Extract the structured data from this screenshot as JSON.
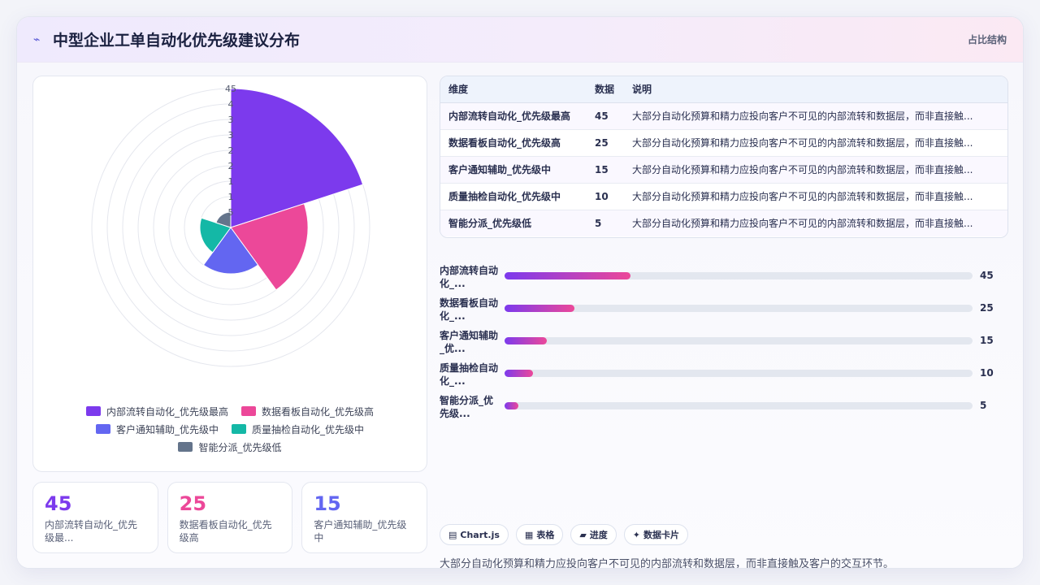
{
  "header": {
    "icon": "chart-icon",
    "title": "中型企业工单自动化优先级建议分布",
    "right_label": "占比结构"
  },
  "colors": {
    "purple": "#7c3aed",
    "pink": "#ec4899",
    "indigo": "#6366f1",
    "teal": "#14b8a6",
    "slate": "#64748b"
  },
  "chart_data": {
    "type": "polarArea",
    "categories": [
      "内部流转自动化_优先级最高",
      "数据看板自动化_优先级高",
      "客户通知辅助_优先级中",
      "质量抽检自动化_优先级中",
      "智能分派_优先级低"
    ],
    "values": [
      45,
      25,
      15,
      10,
      5
    ],
    "colors": [
      "#7c3aed",
      "#ec4899",
      "#6366f1",
      "#14b8a6",
      "#64748b"
    ],
    "rlim": [
      0,
      45
    ],
    "ticks": [
      5,
      10,
      15,
      20,
      25,
      30,
      35,
      40,
      45
    ],
    "tick_labels": [
      "5",
      "1",
      "1",
      "2",
      "2",
      "3",
      "3",
      "4",
      "45"
    ],
    "grid": true,
    "legend_position": "bottom"
  },
  "legend": [
    {
      "label": "内部流转自动化_优先级最高",
      "color": "#7c3aed"
    },
    {
      "label": "数据看板自动化_优先级高",
      "color": "#ec4899"
    },
    {
      "label": "客户通知辅助_优先级中",
      "color": "#6366f1"
    },
    {
      "label": "质量抽检自动化_优先级中",
      "color": "#14b8a6"
    },
    {
      "label": "智能分派_优先级低",
      "color": "#64748b"
    }
  ],
  "kpis": [
    {
      "value": "45",
      "label": "内部流转自动化_优先级最...",
      "color": "#7c3aed"
    },
    {
      "value": "25",
      "label": "数据看板自动化_优先级高",
      "color": "#ec4899"
    },
    {
      "value": "15",
      "label": "客户通知辅助_优先级中",
      "color": "#6366f1"
    }
  ],
  "table": {
    "headers": [
      "维度",
      "数据",
      "说明"
    ],
    "rows": [
      {
        "name": "内部流转自动化_优先级最高",
        "value": "45",
        "desc": "大部分自动化预算和精力应投向客户不可见的内部流转和数据层，而非直接触..."
      },
      {
        "name": "数据看板自动化_优先级高",
        "value": "25",
        "desc": "大部分自动化预算和精力应投向客户不可见的内部流转和数据层，而非直接触..."
      },
      {
        "name": "客户通知辅助_优先级中",
        "value": "15",
        "desc": "大部分自动化预算和精力应投向客户不可见的内部流转和数据层，而非直接触..."
      },
      {
        "name": "质量抽检自动化_优先级中",
        "value": "10",
        "desc": "大部分自动化预算和精力应投向客户不可见的内部流转和数据层，而非直接触..."
      },
      {
        "name": "智能分派_优先级低",
        "value": "5",
        "desc": "大部分自动化预算和精力应投向客户不可见的内部流转和数据层，而非直接触..."
      }
    ]
  },
  "progress": {
    "max": 167,
    "items": [
      {
        "label": "内部流转自动化_...",
        "value": 45,
        "value_text": "45"
      },
      {
        "label": "数据看板自动化_...",
        "value": 25,
        "value_text": "25"
      },
      {
        "label": "客户通知辅助_优...",
        "value": 15,
        "value_text": "15"
      },
      {
        "label": "质量抽检自动化_...",
        "value": 10,
        "value_text": "10"
      },
      {
        "label": "智能分派_优先级...",
        "value": 5,
        "value_text": "5"
      }
    ]
  },
  "chips": [
    {
      "icon": "chart-icon",
      "glyph": "▤",
      "label": "Chart.js"
    },
    {
      "icon": "table-icon",
      "glyph": "▦",
      "label": "表格"
    },
    {
      "icon": "progress-icon",
      "glyph": "▰",
      "label": "进度"
    },
    {
      "icon": "sparkle-icon",
      "glyph": "✦",
      "label": "数据卡片"
    }
  ],
  "footnote": "大部分自动化预算和精力应投向客户不可见的内部流转和数据层，而非直接触及客户的交互环节。"
}
